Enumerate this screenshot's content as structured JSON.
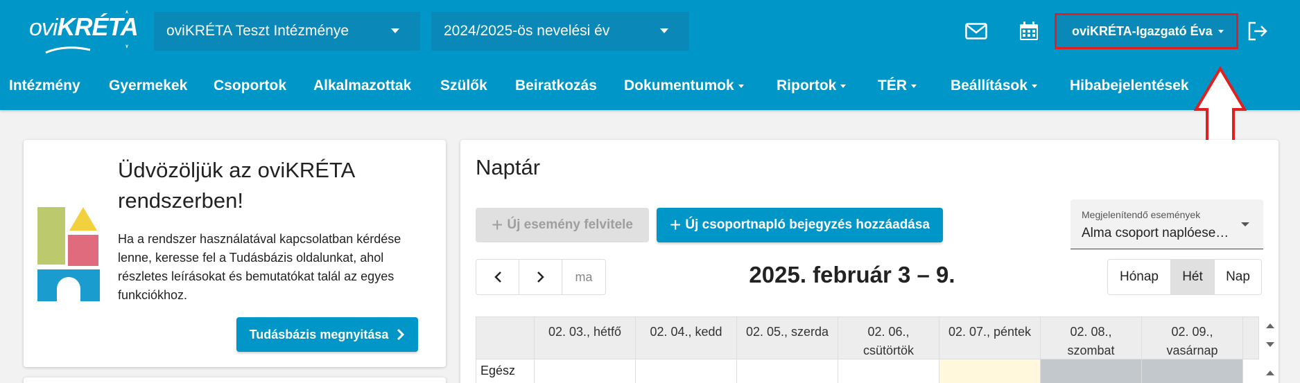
{
  "header": {
    "logo_prefix": "ovi",
    "logo_main": "KRÉTA",
    "institution": "oviKRÉTA Teszt Intézménye",
    "school_year": "2024/2025-ös nevelési év",
    "user": "oviKRÉTA-Igazgató Éva",
    "icons": [
      "mail-icon",
      "calendar-icon",
      "logout-icon"
    ]
  },
  "nav": {
    "items": [
      {
        "label": "Intézmény",
        "dropdown": false
      },
      {
        "label": "Gyermekek",
        "dropdown": false
      },
      {
        "label": "Csoportok",
        "dropdown": false
      },
      {
        "label": "Alkalmazottak",
        "dropdown": false
      },
      {
        "label": "Szülők",
        "dropdown": false
      },
      {
        "label": "Beiratkozás",
        "dropdown": false
      },
      {
        "label": "Dokumentumok",
        "dropdown": true
      },
      {
        "label": "Riportok",
        "dropdown": true
      },
      {
        "label": "TÉR",
        "dropdown": true
      },
      {
        "label": "Beállítások",
        "dropdown": true
      },
      {
        "label": "Hibabejelentések",
        "dropdown": false
      }
    ]
  },
  "welcome": {
    "title": "Üdvözöljük az oviKRÉTA rendszerben!",
    "text": "Ha a rendszer használatával kapcsolatban kérdése lenne, keresse fel a Tudásbázis oldalunkat, ahol részletes leírásokat és bemutatókat talál az egyes funkciókhoz.",
    "button": "Tudásbázis megnyitása"
  },
  "calendar": {
    "title": "Naptár",
    "new_event": "Új esemény felvitele",
    "new_group_log": "Új csoportnapló bejegyzés hozzáadása",
    "filter_label": "Megjelenítendő események",
    "filter_value": "Alma csoport naplóese…",
    "today": "ma",
    "range": "2025. február 3 – 9.",
    "views": {
      "month": "Hónap",
      "week": "Hét",
      "day": "Nap"
    },
    "active_view": "Hét",
    "days": [
      "02. 03., hétfő",
      "02. 04., kedd",
      "02. 05., szerda",
      "02. 06., csütörtök",
      "02. 07., péntek",
      "02. 08., szombat",
      "02. 09., vasárnap"
    ],
    "allday_label": "Egész"
  },
  "colors": {
    "brand": "#0096c7",
    "highlight": "#e02020",
    "today_bg": "#fff8dc",
    "weekend_bg": "#c3c8cc"
  }
}
